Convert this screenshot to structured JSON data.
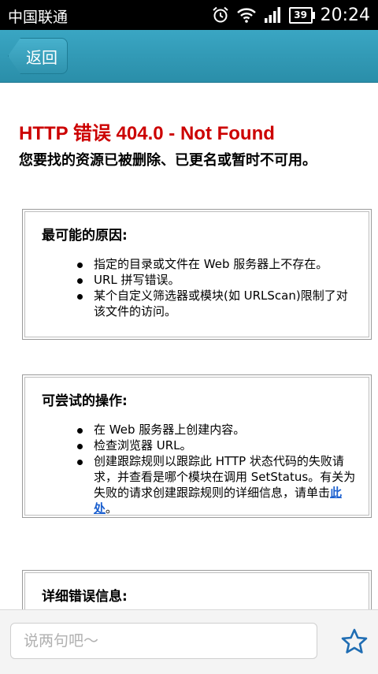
{
  "statusbar": {
    "carrier": "中国联通",
    "battery": "39",
    "time": "20:24"
  },
  "navbar": {
    "back_label": "返回"
  },
  "page": {
    "title": "HTTP 错误 404.0 - Not Found",
    "subtitle": "您要找的资源已被删除、已更名或暂时不可用。"
  },
  "causes": {
    "heading": "最可能的原因:",
    "items": [
      "指定的目录或文件在 Web 服务器上不存在。",
      "URL 拼写错误。",
      "某个自定义筛选器或模块(如 URLScan)限制了对该文件的访问。"
    ]
  },
  "actions": {
    "heading": "可尝试的操作:",
    "items": [
      "在 Web 服务器上创建内容。",
      "检查浏览器 URL。"
    ],
    "last_item_text": "创建跟踪规则以跟踪此 HTTP 状态代码的失败请求，并查看是哪个模块在调用 SetStatus。有关为失败的请求创建跟踪规则的详细信息，请单击",
    "link_text": "此处",
    "last_item_end": "。"
  },
  "details": {
    "heading": "详细错误信息:"
  },
  "comment": {
    "placeholder": "说两句吧～"
  },
  "icons": {
    "favorite": "star-icon",
    "wifi": "wifi-icon",
    "alarm": "alarm-icon",
    "signal": "signal-icon",
    "battery": "battery-icon"
  },
  "colors": {
    "nav": "#2f96b2",
    "error_title": "#cc0000",
    "link": "#1a5fcf",
    "star": "#1f6db3"
  }
}
